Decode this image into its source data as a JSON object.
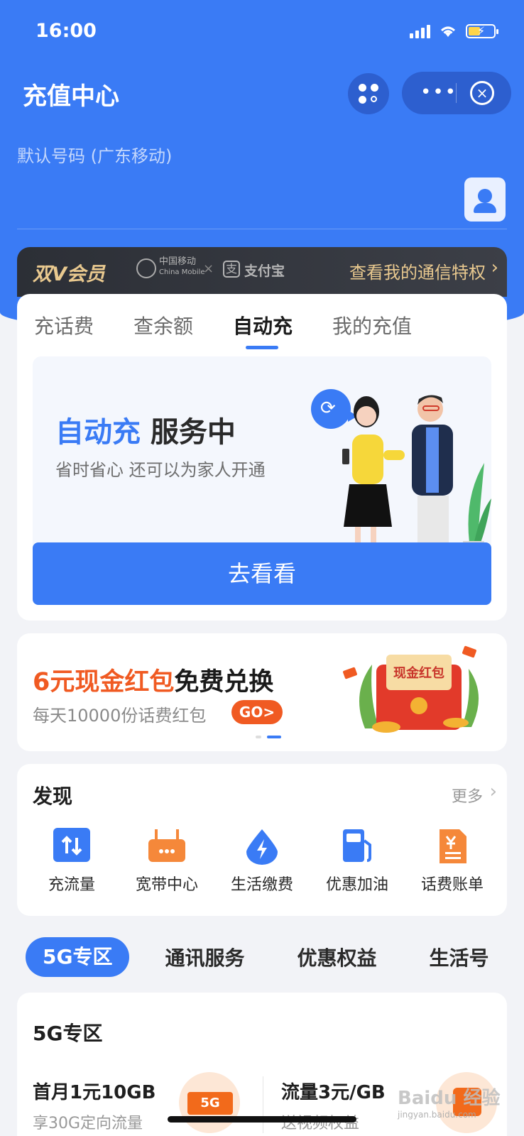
{
  "status_bar": {
    "time": "16:00"
  },
  "header": {
    "title": "充值中心",
    "default_number": "默认号码 (广东移动)"
  },
  "vip": {
    "title": "双V会员",
    "partner1_cn": "中国移动",
    "partner1_en": "China Mobile",
    "times": "×",
    "partner2_icon": "支",
    "partner2": "支付宝",
    "link": "查看我的通信特权",
    "chevron": "›"
  },
  "tabs": [
    "充话费",
    "查余额",
    "自动充",
    "我的充值"
  ],
  "banner": {
    "title_blue": "自动充",
    "title_rest": " 服务中",
    "subtitle": "省时省心 还可以为家人开通",
    "cta": "去看看"
  },
  "promo": {
    "title_orange": "6元现金红包",
    "title_rest": "免费兑换",
    "subtitle": "每天10000份话费红包",
    "go": "GO>",
    "image_text": "现金红包"
  },
  "discover": {
    "title": "发现",
    "more": "更多",
    "items": [
      {
        "label": "充流量",
        "icon": "data-recharge-icon",
        "color": "#3a7bf5"
      },
      {
        "label": "宽带中心",
        "icon": "router-icon",
        "color": "#f5883a"
      },
      {
        "label": "生活缴费",
        "icon": "lightning-drop-icon",
        "color": "#3a7bf5"
      },
      {
        "label": "优惠加油",
        "icon": "fuel-pump-icon",
        "color": "#3a7bf5"
      },
      {
        "label": "话费账单",
        "icon": "bill-icon",
        "color": "#f5883a"
      }
    ]
  },
  "categories": [
    "5G专区",
    "通讯服务",
    "优惠权益",
    "生活号"
  ],
  "zone": {
    "title": "5G专区",
    "product1_title": "首月1元10GB",
    "product1_sub": "享30G定向流量",
    "product1_badge": "5G",
    "product2_title": "流量3元/GB",
    "product2_sub": "送视频权益"
  },
  "watermark": {
    "text": "Baidu 经验",
    "sub": "jingyan.baidu.com"
  },
  "colors": {
    "primary": "#3a7bf5",
    "orange": "#f05a22",
    "gold": "#e9c98f"
  }
}
